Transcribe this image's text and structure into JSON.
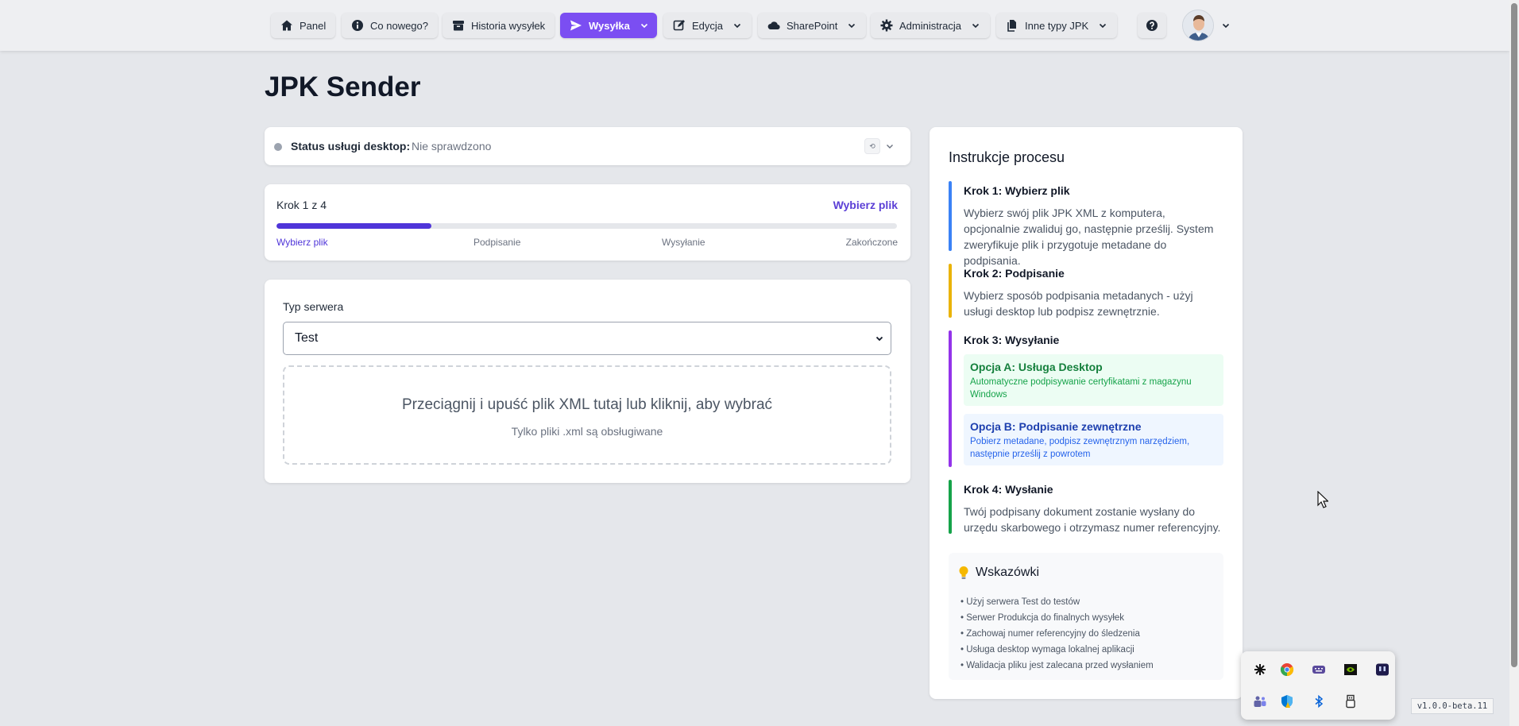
{
  "nav": {
    "items": [
      {
        "label": "Panel",
        "icon": "home-icon"
      },
      {
        "label": "Co nowego?",
        "icon": "info-icon"
      },
      {
        "label": "Historia wysyłek",
        "icon": "archive-icon"
      },
      {
        "label": "Wysyłka",
        "icon": "send-icon",
        "active": true
      },
      {
        "label": "Edycja",
        "icon": "edit-icon"
      },
      {
        "label": "SharePoint",
        "icon": "cloud-icon"
      },
      {
        "label": "Administracja",
        "icon": "gear-icon"
      },
      {
        "label": "Inne typy JPK",
        "icon": "files-icon"
      }
    ],
    "help_icon": "question-icon",
    "accent": "#7b4ef2"
  },
  "page": {
    "title": "JPK Sender"
  },
  "status": {
    "label": "Status usługi desktop:",
    "value": "Nie sprawdzono",
    "refresh_icon": "refresh-icon"
  },
  "progress": {
    "step_count": "Krok 1 z 4",
    "current_step": "Wybierz plik",
    "fraction": 0.25,
    "steps": [
      "Wybierz plik",
      "Podpisanie",
      "Wysyłanie",
      "Zakończone"
    ]
  },
  "form": {
    "server_label": "Typ serwera",
    "server_value": "Test",
    "drop_main": "Przeciągnij i upuść plik XML tutaj lub kliknij, aby wybrać",
    "drop_sub": "Tylko pliki .xml są obsługiwane"
  },
  "instructions": {
    "title": "Instrukcje procesu",
    "step1": {
      "title": "Krok 1: Wybierz plik",
      "text": "Wybierz swój plik JPK XML z komputera, opcjonalnie zwaliduj go, następnie prześlij. System zweryfikuje plik i przygotuje metadane do podpisania."
    },
    "step2": {
      "title": "Krok 2: Podpisanie",
      "text": "Wybierz sposób podpisania metadanych - użyj usługi desktop lub podpisz zewnętrznie."
    },
    "step3": {
      "title": "Krok 3: Wysyłanie",
      "option_a": {
        "title": "Opcja A: Usługa Desktop",
        "text": "Automatyczne podpisywanie certyfikatami z magazynu Windows"
      },
      "option_b": {
        "title": "Opcja B: Podpisanie zewnętrzne",
        "text": "Pobierz metadane, podpisz zewnętrznym narzędziem, następnie prześlij z powrotem"
      }
    },
    "step4": {
      "title": "Krok 4: Wysłanie",
      "text": "Twój podpisany dokument zostanie wysłany do urzędu skarbowego i otrzymasz numer referencyjny."
    }
  },
  "tips": {
    "icon": "lightbulb-icon",
    "title": "Wskazówki",
    "items": [
      "Użyj serwera Test do testów",
      "Serwer Produkcja do finalnych wysyłek",
      "Zachowaj numer referencyjny do śledzenia",
      "Usługa desktop wymaga lokalnej aplikacji",
      "Walidacja pliku jest zalecana przed wysłaniem"
    ]
  },
  "tray": {
    "icons": [
      "asterisk-icon",
      "chrome-icon",
      "keyboard-icon",
      "nvidia-icon",
      "chat-icon",
      "teams-icon",
      "security-icon",
      "bluetooth-icon",
      "usb-icon"
    ]
  },
  "version": "v1.0.0-beta.11"
}
